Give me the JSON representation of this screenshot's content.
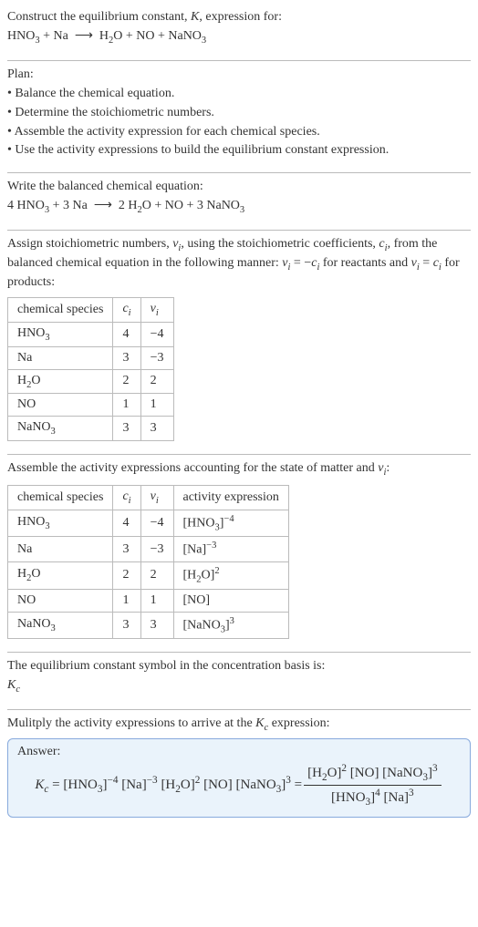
{
  "header": {
    "title_html": "Construct the equilibrium constant, <span class='ital'>K</span>, expression for:",
    "reaction_html": "HNO<sub>3</sub> + Na &nbsp;⟶&nbsp; H<sub>2</sub>O + NO + NaNO<sub>3</sub>"
  },
  "plan": {
    "heading": "Plan:",
    "steps": [
      "• Balance the chemical equation.",
      "• Determine the stoichiometric numbers.",
      "• Assemble the activity expression for each chemical species.",
      "• Use the activity expressions to build the equilibrium constant expression."
    ]
  },
  "balanced": {
    "heading": "Write the balanced chemical equation:",
    "equation_html": "4 HNO<sub>3</sub> + 3 Na &nbsp;⟶&nbsp; 2 H<sub>2</sub>O + NO + 3 NaNO<sub>3</sub>"
  },
  "assign": {
    "text_html": "Assign stoichiometric numbers, <span class='ital'>ν<sub>i</sub></span>, using the stoichiometric coefficients, <span class='ital'>c<sub>i</sub></span>, from the balanced chemical equation in the following manner: <span class='ital'>ν<sub>i</sub></span> = −<span class='ital'>c<sub>i</sub></span> for reactants and <span class='ital'>ν<sub>i</sub></span> = <span class='ital'>c<sub>i</sub></span> for products:",
    "columns": [
      "chemical species",
      "<span class='ital'>c<sub>i</sub></span>",
      "<span class='ital'>ν<sub>i</sub></span>"
    ],
    "rows": [
      {
        "species_html": "HNO<sub>3</sub>",
        "c": "4",
        "v": "−4"
      },
      {
        "species_html": "Na",
        "c": "3",
        "v": "−3"
      },
      {
        "species_html": "H<sub>2</sub>O",
        "c": "2",
        "v": "2"
      },
      {
        "species_html": "NO",
        "c": "1",
        "v": "1"
      },
      {
        "species_html": "NaNO<sub>3</sub>",
        "c": "3",
        "v": "3"
      }
    ]
  },
  "assemble": {
    "heading_html": "Assemble the activity expressions accounting for the state of matter and <span class='ital'>ν<sub>i</sub></span>:",
    "columns": [
      "chemical species",
      "<span class='ital'>c<sub>i</sub></span>",
      "<span class='ital'>ν<sub>i</sub></span>",
      "activity expression"
    ],
    "rows": [
      {
        "species_html": "HNO<sub>3</sub>",
        "c": "4",
        "v": "−4",
        "activity_html": "[HNO<sub>3</sub>]<sup>−4</sup>"
      },
      {
        "species_html": "Na",
        "c": "3",
        "v": "−3",
        "activity_html": "[Na]<sup>−3</sup>"
      },
      {
        "species_html": "H<sub>2</sub>O",
        "c": "2",
        "v": "2",
        "activity_html": "[H<sub>2</sub>O]<sup>2</sup>"
      },
      {
        "species_html": "NO",
        "c": "1",
        "v": "1",
        "activity_html": "[NO]"
      },
      {
        "species_html": "NaNO<sub>3</sub>",
        "c": "3",
        "v": "3",
        "activity_html": "[NaNO<sub>3</sub>]<sup>3</sup>"
      }
    ]
  },
  "basis": {
    "heading": "The equilibrium constant symbol in the concentration basis is:",
    "symbol_html": "<span class='ital'>K<sub>c</sub></span>"
  },
  "multiply": {
    "heading_html": "Mulitply the activity expressions to arrive at the <span class='ital'>K<sub>c</sub></span> expression:"
  },
  "answer": {
    "label": "Answer:",
    "lhs_html": "<span class='ital'>K<sub>c</sub></span> = [HNO<sub>3</sub>]<sup>−4</sup> [Na]<sup>−3</sup> [H<sub>2</sub>O]<sup>2</sup> [NO] [NaNO<sub>3</sub>]<sup>3</sup> = ",
    "frac_num_html": "[H<sub>2</sub>O]<sup>2</sup> [NO] [NaNO<sub>3</sub>]<sup>3</sup>",
    "frac_den_html": "[HNO<sub>3</sub>]<sup>4</sup> [Na]<sup>3</sup>"
  }
}
